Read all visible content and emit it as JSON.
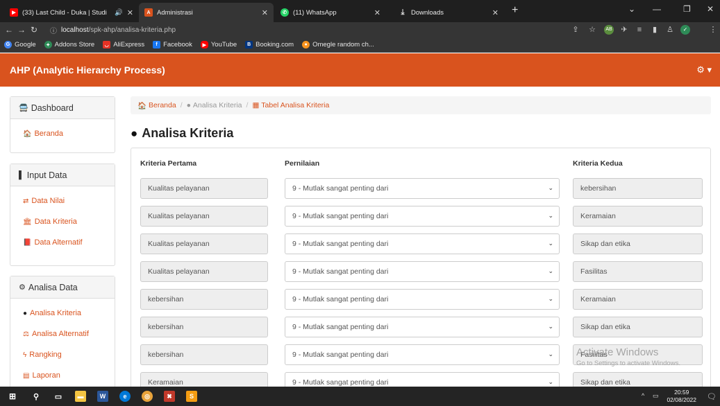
{
  "browser": {
    "tabs": [
      {
        "title": "(33) Last Child - Duka | Studi",
        "icon": "youtube-icon",
        "color": "#ff0000",
        "active": false,
        "audio": true
      },
      {
        "title": "Administrasi",
        "icon": "page-icon",
        "color": "#d9531e",
        "active": true
      },
      {
        "title": "(11) WhatsApp",
        "icon": "whatsapp-icon",
        "color": "#25d366",
        "active": false
      },
      {
        "title": "Downloads",
        "icon": "download-icon",
        "color": "#5f6368",
        "active": false
      }
    ],
    "address": {
      "host": "localhost",
      "path": "/spk-ahp/analisa-kriteria.php"
    },
    "bookmarks": [
      {
        "label": "Google",
        "icon": "google-icon",
        "color": "#4285f4"
      },
      {
        "label": "Addons Store",
        "icon": "addons-icon",
        "color": "#2e8b57"
      },
      {
        "label": "AliExpress",
        "icon": "aliexpress-icon",
        "color": "#e43225"
      },
      {
        "label": "Facebook",
        "icon": "facebook-icon",
        "color": "#1877f2"
      },
      {
        "label": "YouTube",
        "icon": "youtube-icon",
        "color": "#ff0000"
      },
      {
        "label": "Booking.com",
        "icon": "booking-icon",
        "color": "#003580"
      },
      {
        "label": "Omegle random ch...",
        "icon": "omegle-icon",
        "color": "#f7931e"
      }
    ]
  },
  "app": {
    "brand": "AHP (Analytic Hierarchy Process)",
    "accent": "#d9531e"
  },
  "sidebar": {
    "dashboard": {
      "title": "Dashboard",
      "items": [
        {
          "label": "Beranda"
        }
      ]
    },
    "input": {
      "title": "Input Data",
      "items": [
        {
          "label": "Data Nilai"
        },
        {
          "label": "Data Kriteria"
        },
        {
          "label": "Data Alternatif"
        }
      ]
    },
    "analisa": {
      "title": "Analisa Data",
      "items": [
        {
          "label": "Analisa Kriteria"
        },
        {
          "label": "Analisa Alternatif"
        },
        {
          "label": "Rangking"
        },
        {
          "label": "Laporan"
        }
      ]
    }
  },
  "breadcrumb": {
    "home": "Beranda",
    "middle": "Analisa Kriteria",
    "current": "Tabel Analisa Kriteria"
  },
  "page_title": "Analisa Kriteria",
  "table": {
    "headers": {
      "first": "Kriteria Pertama",
      "rating": "Pernilaian",
      "second": "Kriteria Kedua"
    },
    "rows": [
      {
        "first": "Kualitas pelayanan",
        "rating": "9 - Mutlak sangat penting dari",
        "second": "kebersihan"
      },
      {
        "first": "Kualitas pelayanan",
        "rating": "9 - Mutlak sangat penting dari",
        "second": "Keramaian"
      },
      {
        "first": "Kualitas pelayanan",
        "rating": "9 - Mutlak sangat penting dari",
        "second": "Sikap dan etika"
      },
      {
        "first": "Kualitas pelayanan",
        "rating": "9 - Mutlak sangat penting dari",
        "second": "Fasilitas"
      },
      {
        "first": "kebersihan",
        "rating": "9 - Mutlak sangat penting dari",
        "second": "Keramaian"
      },
      {
        "first": "kebersihan",
        "rating": "9 - Mutlak sangat penting dari",
        "second": "Sikap dan etika"
      },
      {
        "first": "kebersihan",
        "rating": "9 - Mutlak sangat penting dari",
        "second": "Fasilitas"
      },
      {
        "first": "Keramaian",
        "rating": "9 - Mutlak sangat penting dari",
        "second": "Sikap dan etika"
      }
    ]
  },
  "watermark": {
    "line1": "Activate Windows",
    "line2": "Go to Settings to activate Windows."
  },
  "taskbar": {
    "time": "20:59",
    "date": "02/08/2022"
  }
}
